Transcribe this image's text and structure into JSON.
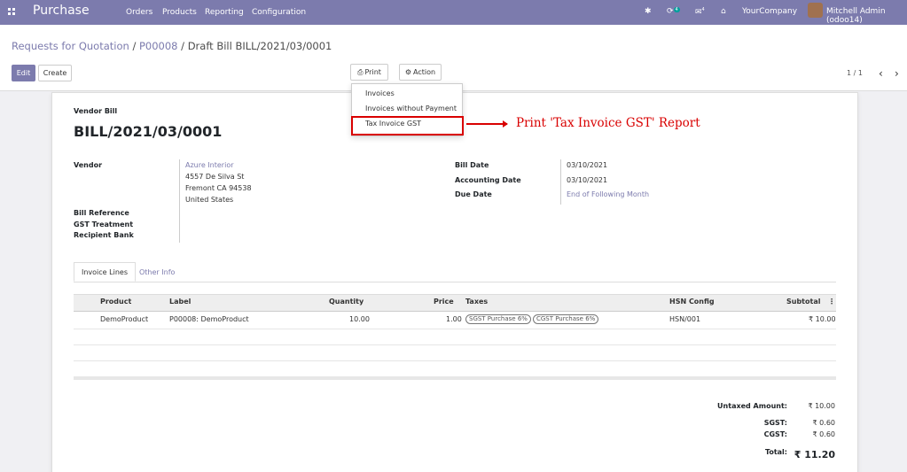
{
  "navbar": {
    "app_name": "Purchase",
    "menu": [
      "Orders",
      "Products",
      "Reporting",
      "Configuration"
    ],
    "activity_count": "4",
    "messages_count": "4",
    "company": "YourCompany",
    "user": "Mitchell Admin (odoo14)"
  },
  "breadcrumb": {
    "item1": "Requests for Quotation",
    "sep": "/",
    "item2": "P00008",
    "current": "Draft Bill BILL/2021/03/0001"
  },
  "toolbar": {
    "edit_label": "Edit",
    "create_label": "Create",
    "print_label": "Print",
    "action_label": "Action",
    "pager": "1 / 1"
  },
  "print_menu": {
    "items": [
      "Invoices",
      "Invoices without Payment",
      "Tax Invoice GST"
    ]
  },
  "annotation": "Print 'Tax Invoice GST' Report",
  "form": {
    "type_label": "Vendor Bill",
    "number": "BILL/2021/03/0001",
    "vendor_label": "Vendor",
    "vendor_name": "Azure Interior",
    "vendor_address": [
      "4557 De Silva St",
      "Fremont CA 94538",
      "United States"
    ],
    "bill_reference_label": "Bill Reference",
    "gst_treatment_label": "GST Treatment",
    "recipient_bank_label": "Recipient Bank",
    "bill_date_label": "Bill Date",
    "bill_date": "03/10/2021",
    "accounting_date_label": "Accounting Date",
    "accounting_date": "03/10/2021",
    "due_date_label": "Due Date",
    "due_date": "End of Following Month"
  },
  "tabs": [
    "Invoice Lines",
    "Other Info"
  ],
  "lines_table": {
    "columns": [
      "Product",
      "Label",
      "Quantity",
      "Price",
      "Taxes",
      "HSN Config",
      "Subtotal"
    ],
    "rows": [
      {
        "product": "DemoProduct",
        "label": "P00008: DemoProduct",
        "quantity": "10.00",
        "price": "1.00",
        "taxes": [
          "SGST Purchase 6%",
          "CGST Purchase 6%"
        ],
        "hsn": "HSN/001",
        "subtotal": "₹ 10.00"
      }
    ]
  },
  "totals": {
    "untaxed_label": "Untaxed Amount:",
    "untaxed": "₹ 10.00",
    "sgst_label": "SGST:",
    "sgst": "₹ 0.60",
    "cgst_label": "CGST:",
    "cgst": "₹ 0.60",
    "total_label": "Total:",
    "total": "₹ 11.20"
  },
  "colors": {
    "brand": "#7c7bad",
    "annotation": "#d90000"
  }
}
